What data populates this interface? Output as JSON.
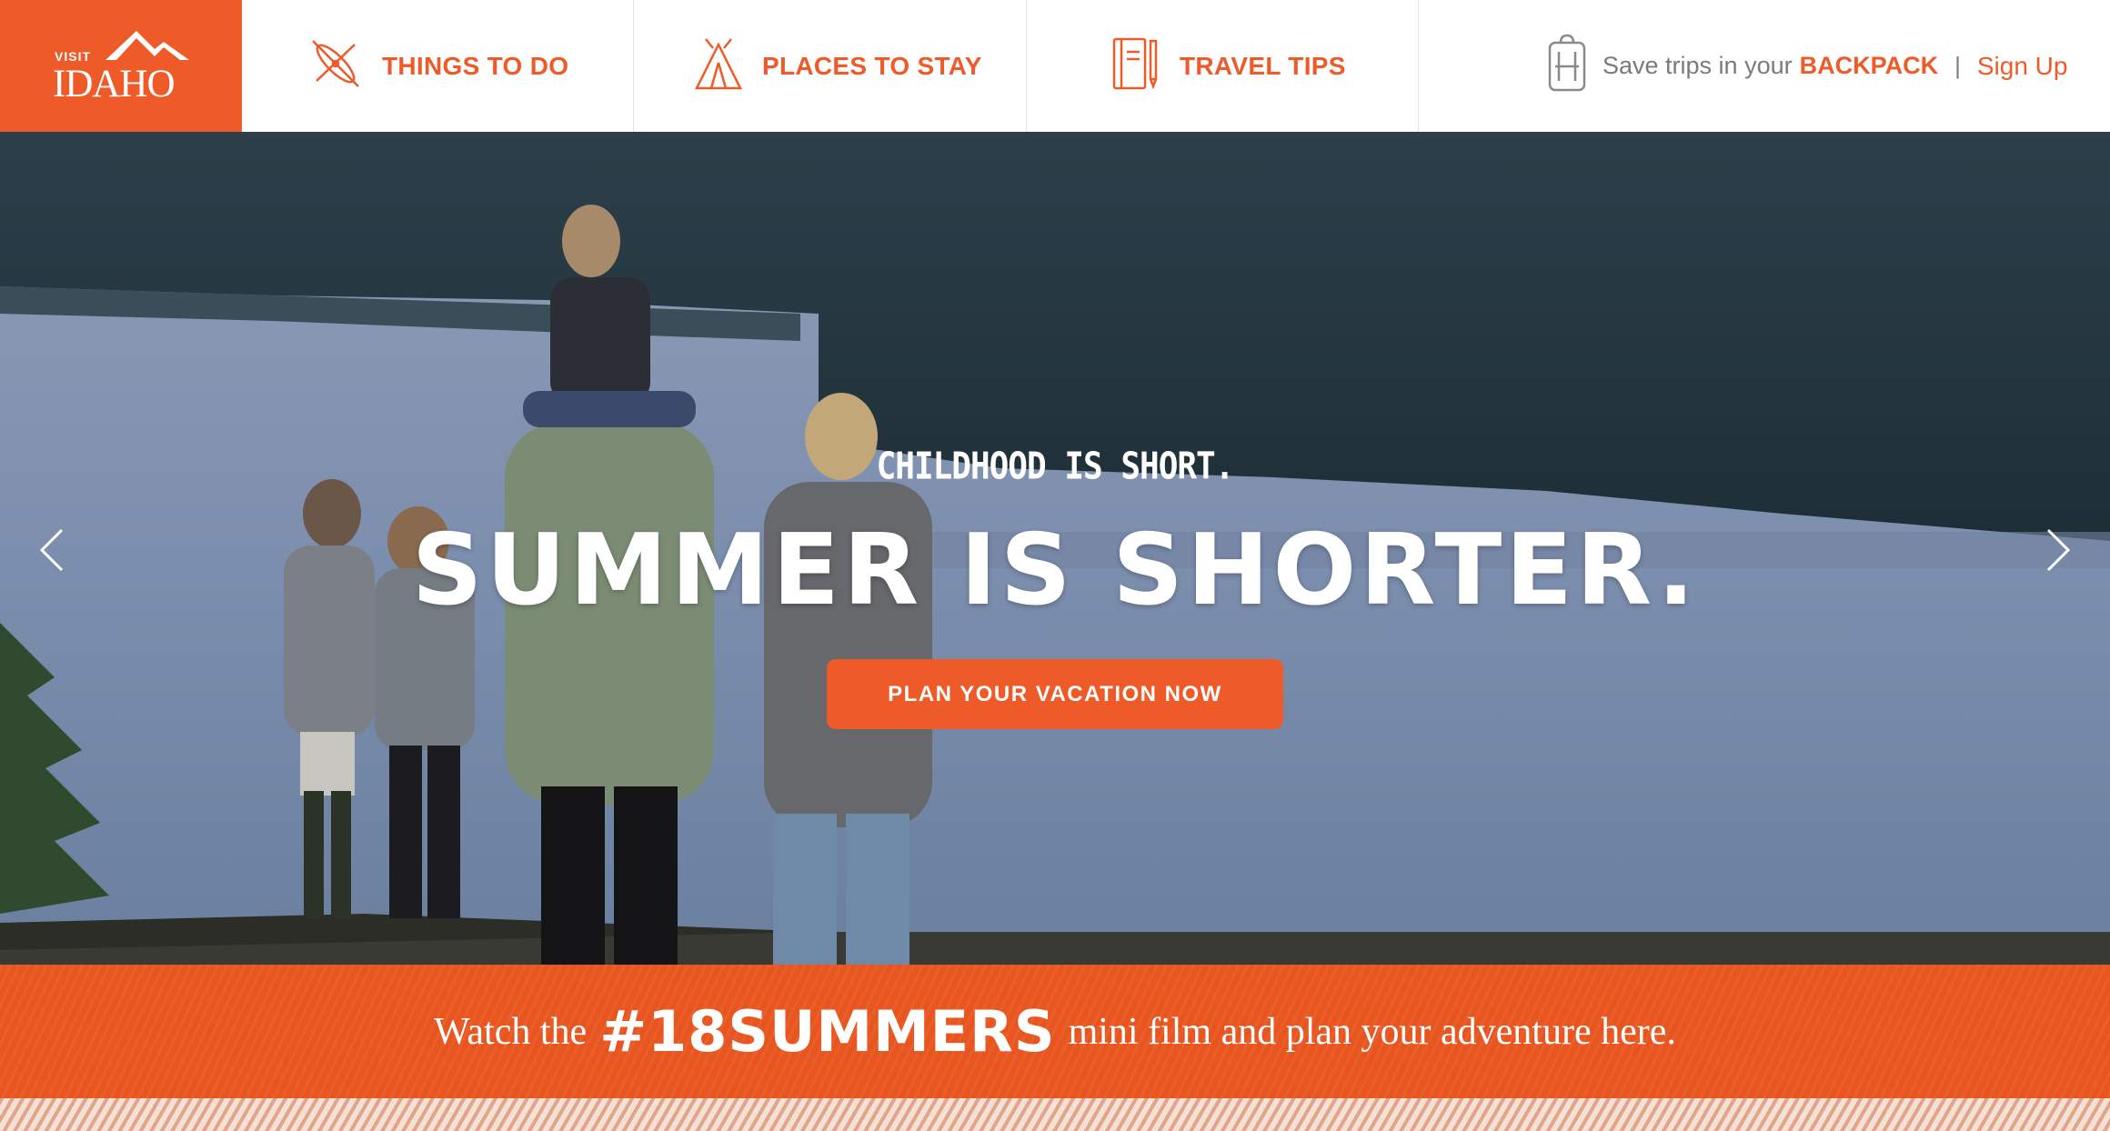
{
  "header": {
    "logo": {
      "visit": "VISIT",
      "name": "IDAHO"
    },
    "nav": [
      {
        "label": "THINGS TO DO",
        "icon": "kayak-icon"
      },
      {
        "label": "PLACES TO STAY",
        "icon": "tent-icon"
      },
      {
        "label": "TRAVEL TIPS",
        "icon": "notebook-icon"
      }
    ],
    "account": {
      "icon": "backpack-icon",
      "save_text": "Save trips in your",
      "backpack_link": "BACKPACK",
      "divider": "|",
      "signup_link": "Sign Up"
    }
  },
  "hero": {
    "subtitle": "CHILDHOOD IS SHORT.",
    "headline": "SUMMER IS SHORTER.",
    "cta_label": "PLAN YOUR VACATION NOW",
    "prev_icon": "chevron-left-icon",
    "next_icon": "chevron-right-icon"
  },
  "promo": {
    "pre": "Watch the",
    "hashtag": "#18SUMMERS",
    "post": "mini film and plan your adventure here."
  },
  "colors": {
    "brand_orange": "#ee5a28",
    "nav_text_gray": "#7a7a7a",
    "promo_band": "#e8551f"
  }
}
